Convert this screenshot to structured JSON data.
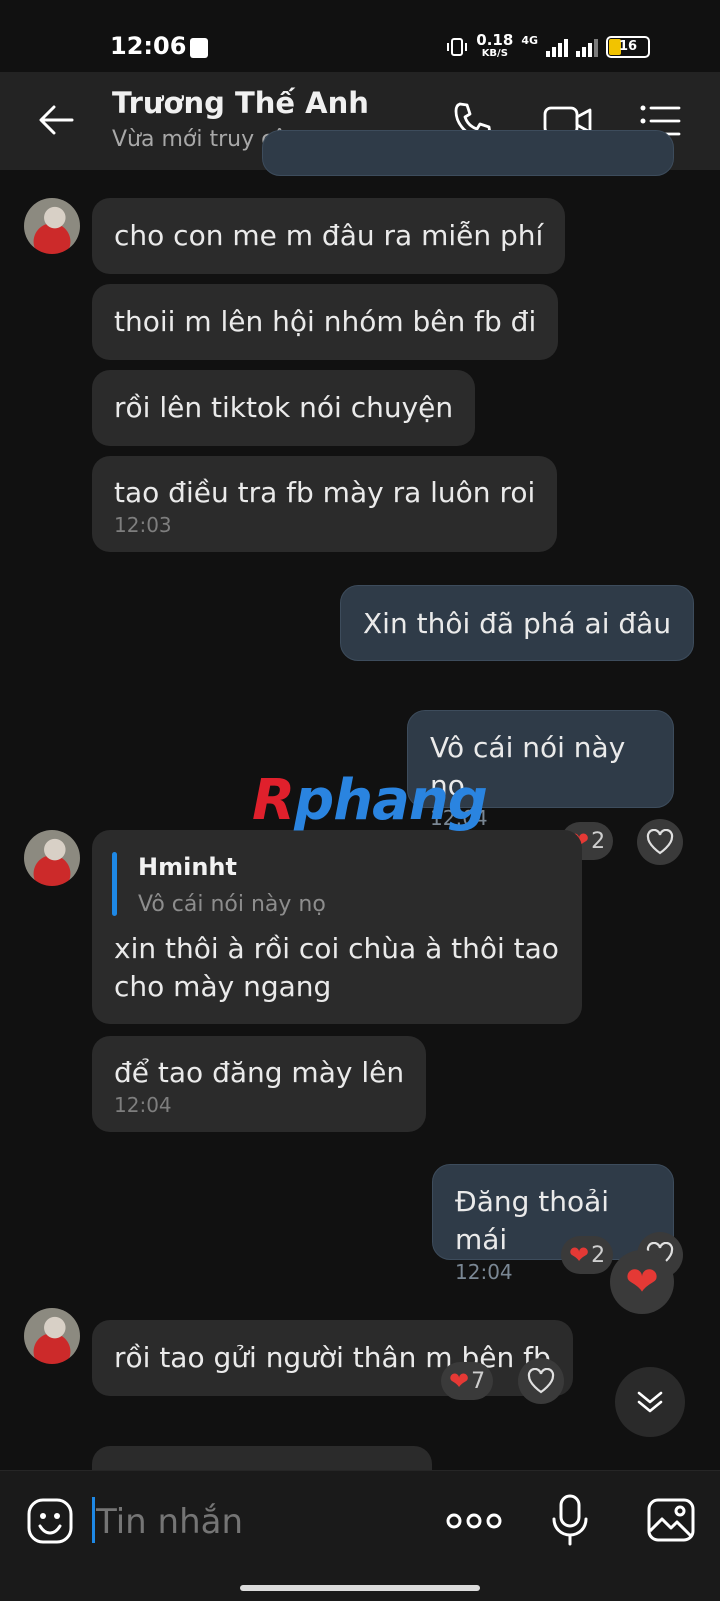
{
  "status_bar": {
    "time": "12:06",
    "net_speed": "0.18",
    "net_unit": "KB/S",
    "network": "4G",
    "battery": "16"
  },
  "header": {
    "contact_name": "Trương Thế Anh",
    "contact_status": "Vừa mới truy cập",
    "icons": [
      "back-arrow-icon",
      "phone-icon",
      "video-icon",
      "menu-list-icon"
    ]
  },
  "messages": [
    {
      "from": "them",
      "text": "cho con me m đâu ra miễn phí"
    },
    {
      "from": "them",
      "text": "thoii m lên hội nhóm bên fb đi"
    },
    {
      "from": "them",
      "text": "rồi lên tiktok nói chuyện"
    },
    {
      "from": "them",
      "text": "tao điều tra fb mày ra luôn roi",
      "time": "12:03"
    },
    {
      "from": "me",
      "text": "Xin thôi đã phá ai đâu",
      "reaction_count": "2"
    },
    {
      "from": "me",
      "text": "Vô cái nói này nọ",
      "time": "12:04"
    },
    {
      "from": "them",
      "reply_name": "Hminht",
      "reply_text": "Vô cái nói này nọ",
      "text_line1": "xin thôi à rồi coi chùa à thôi tao",
      "text_line2": "cho mày ngang"
    },
    {
      "from": "them",
      "text": "để tao đăng mày lên",
      "time": "12:04"
    },
    {
      "from": "me",
      "text": "Đăng thoải mái",
      "time": "12:04",
      "reaction_count": "2"
    },
    {
      "from": "them",
      "text": "rồi tao gửi người thân m bên fb",
      "reaction_count": "7"
    }
  ],
  "watermark": {
    "first": "R",
    "rest": "phang"
  },
  "composer": {
    "placeholder": "Tin nhắn"
  },
  "colors": {
    "accent": "#1e88e5",
    "heart": "#e53935",
    "outgoing_bubble": "#2f3b48",
    "incoming_bubble": "#2b2b2b"
  }
}
